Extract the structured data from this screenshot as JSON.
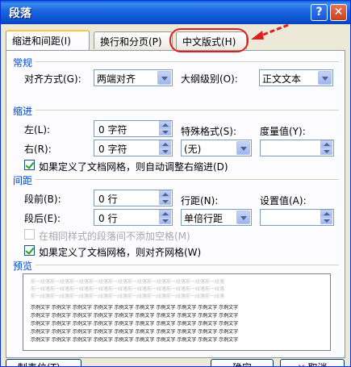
{
  "window": {
    "title": "段落",
    "help_glyph": "?",
    "close_glyph": "✕"
  },
  "tabs": [
    {
      "label": "缩进和间距(I)",
      "active": true
    },
    {
      "label": "换行和分页(P)",
      "active": false
    },
    {
      "label": "中文版式(H)",
      "active": false
    }
  ],
  "general": {
    "title": "常规",
    "alignment_label": "对齐方式(G):",
    "alignment_value": "两端对齐",
    "outline_label": "大纲级别(O):",
    "outline_value": "正文文本"
  },
  "indent": {
    "title": "缩进",
    "left_label": "左(L):",
    "left_value": "0 字符",
    "right_label": "右(R):",
    "right_value": "0 字符",
    "special_label": "特殊格式(S):",
    "special_value": "(无)",
    "measure_label": "度量值(Y):",
    "measure_value": "",
    "auto_adjust_label": "如果定义了文档网格，则自动调整右缩进(D)",
    "auto_adjust_checked": true
  },
  "spacing": {
    "title": "间距",
    "before_label": "段前(B):",
    "before_value": "0 行",
    "after_label": "段后(E):",
    "after_value": "0 行",
    "line_label": "行距(N):",
    "line_value": "单倍行距",
    "setting_label": "设置值(A):",
    "setting_value": "",
    "no_space_label": "在相同样式的段落间不添加空格(M)",
    "no_space_checked": false,
    "no_space_disabled": true,
    "snap_grid_label": "如果定义了文档网格，则对齐网格(W)",
    "snap_grid_checked": true
  },
  "preview": {
    "title": "预览",
    "prev_text": "前一段落前一段落前一段落前一段落前一段落前一段落前一段落前一段落前一段落前一段落",
    "sample_text": "示例文字 示例文字 示例文字 示例文字 示例文字 示例文字 示例文字 示例文字 示例文字 示例文字"
  },
  "buttons": {
    "tabs_label": "制表位(T)...",
    "ok_label": "确定",
    "cancel_label": "取消"
  },
  "colors": {
    "highlight": "#e0201e",
    "section_title": "#0046d5",
    "title_bar": "#0a4fcc"
  }
}
